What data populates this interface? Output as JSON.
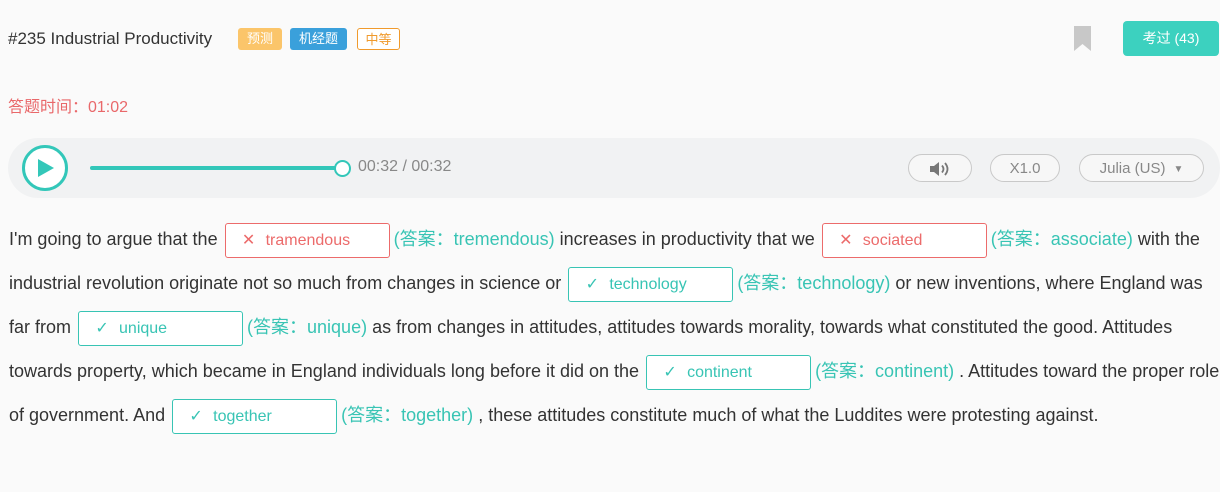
{
  "header": {
    "title": "#235 Industrial Productivity",
    "tags": [
      "预测",
      "机经题",
      "中等"
    ],
    "exam_button": "考过 (43)"
  },
  "timer": "答题时间：01:02",
  "player": {
    "time": "00:32 / 00:32",
    "progress": 1.0,
    "speed": "X1.0",
    "voice": "Julia (US)"
  },
  "colors": {
    "accent": "#38c4b4",
    "error": "#ec6b6b",
    "timer": "#e9686a",
    "tag_predict": "#fbc56a",
    "tag_jijing": "#3aa0db",
    "tag_medium": "#f09a2c"
  },
  "passage": {
    "t1": "I'm going to argue that the",
    "b1": {
      "value": "tramendous",
      "status": "wrong",
      "answer": "(答案：tremendous)"
    },
    "t2": "increases in productivity that we",
    "b2": {
      "value": "sociated",
      "status": "wrong",
      "answer": "(答案：associate)"
    },
    "t3": "with the industrial revolution originate not so much from changes in science or",
    "b3": {
      "value": "technology",
      "status": "correct",
      "answer": "(答案：technology)"
    },
    "t4": "or new inventions, where England was far from",
    "b4": {
      "value": "unique",
      "status": "correct",
      "answer": "(答案：unique)"
    },
    "t5": "as from changes in attitudes, attitudes towards morality, towards what constituted the good. Attitudes towards property, which became in England individuals long before it did on the",
    "b5": {
      "value": "continent",
      "status": "correct",
      "answer": "(答案：continent)"
    },
    "t6": ". Attitudes toward the proper role of government. And",
    "b6": {
      "value": "together",
      "status": "correct",
      "answer": "(答案：together)"
    },
    "t7": ", these attitudes constitute much of what the Luddites were protesting against."
  },
  "icons": {
    "wrong": "✕",
    "correct": "✓"
  }
}
